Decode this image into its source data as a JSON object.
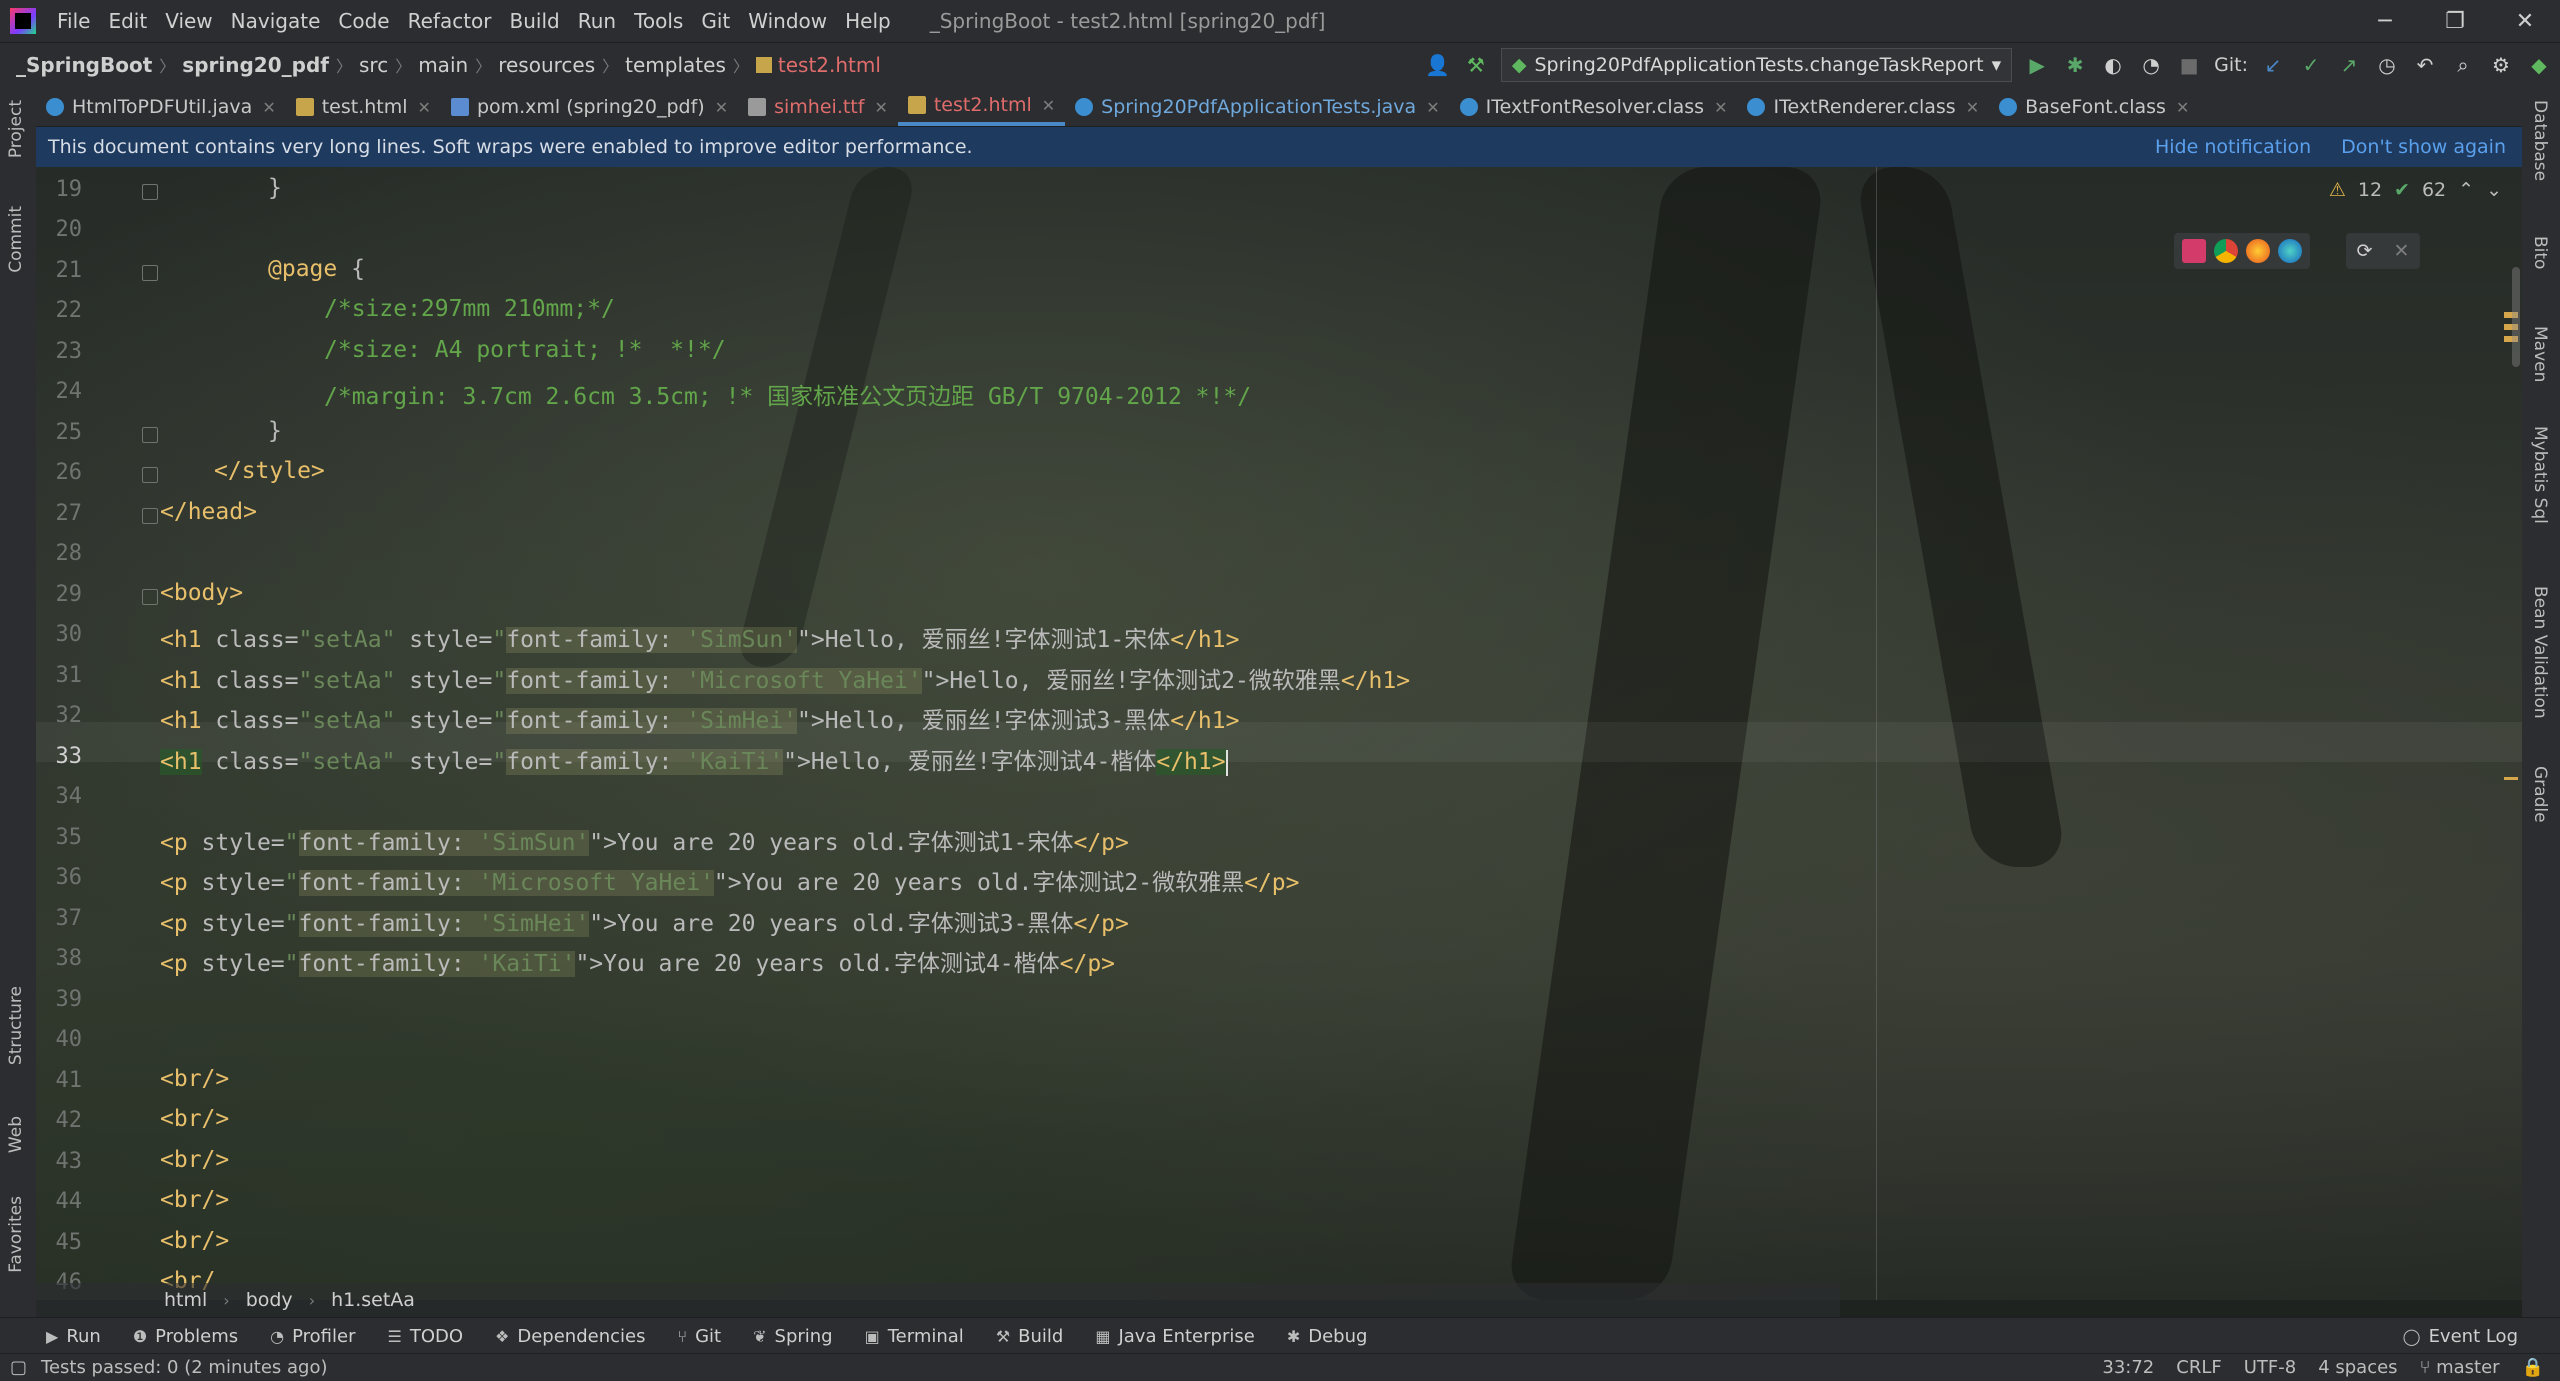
{
  "menu": [
    "File",
    "Edit",
    "View",
    "Navigate",
    "Code",
    "Refactor",
    "Build",
    "Run",
    "Tools",
    "Git",
    "Window",
    "Help"
  ],
  "window_title": "_SpringBoot - test2.html [spring20_pdf]",
  "breadcrumb_nav": [
    "_SpringBoot",
    "spring20_pdf",
    "src",
    "main",
    "resources",
    "templates",
    "test2.html"
  ],
  "run_config": "Spring20PdfApplicationTests.changeTaskReport",
  "git_label": "Git:",
  "tabs": [
    {
      "label": "HtmlToPDFUtil.java",
      "active": false,
      "color": "normal"
    },
    {
      "label": "test.html",
      "active": false,
      "color": "normal"
    },
    {
      "label": "pom.xml (spring20_pdf)",
      "active": false,
      "color": "normal"
    },
    {
      "label": "simhei.ttf",
      "active": false,
      "color": "red"
    },
    {
      "label": "test2.html",
      "active": true,
      "color": "red"
    },
    {
      "label": "Spring20PdfApplicationTests.java",
      "active": false,
      "color": "blue"
    },
    {
      "label": "ITextFontResolver.class",
      "active": false,
      "color": "normal"
    },
    {
      "label": "ITextRenderer.class",
      "active": false,
      "color": "normal"
    },
    {
      "label": "BaseFont.class",
      "active": false,
      "color": "normal"
    }
  ],
  "notification": {
    "message": "This document contains very long lines. Soft wraps were enabled to improve editor performance.",
    "hide": "Hide notification",
    "dont_show": "Don't show again"
  },
  "inspection": {
    "warnings": "12",
    "ok": "62"
  },
  "line_numbers": [
    "19",
    "20",
    "21",
    "22",
    "23",
    "24",
    "25",
    "26",
    "27",
    "28",
    "29",
    "30",
    "31",
    "32",
    "33",
    "34",
    "35",
    "36",
    "37",
    "38",
    "39",
    "40",
    "41",
    "42",
    "43",
    "44",
    "45",
    "46"
  ],
  "current_line": "33",
  "code": {
    "l19": "}",
    "l21_at": "@page",
    "l21_br": " {",
    "l22": "/*size:297mm 210mm;*/",
    "l23": "/*size: A4 portrait; !*  *!*/",
    "l24": "/*margin: 3.7cm 2.6cm 3.5cm; !* 国家标准公文页边距 GB/T 9704-2012 *!*/",
    "l25": "}",
    "l26": "</style>",
    "l27": "</head>",
    "l29": "<body>",
    "h1_open": "<h1",
    "h1_class_attr": " class=",
    "h1_class_val": "\"setAa\"",
    "style_attr": " style=",
    "style_q": "\"",
    "ff": "font-family: ",
    "l30_font": "'SimSun'",
    "l30_text": "\">Hello, 爱丽丝!字体测试1-宋体",
    "l31_font": "'Microsoft YaHei'",
    "l31_text": "\">Hello, 爱丽丝!字体测试2-微软雅黑",
    "l32_font": "'SimHei'",
    "l32_text": "\">Hello, 爱丽丝!字体测试3-黑体",
    "l33_font": "'KaiTi'",
    "l33_text": "\">Hello, 爱丽丝!字体测试4-楷体",
    "h1_close": "</h1>",
    "h1_close_open": "</h1",
    "h1_close_gt": ">",
    "p_open": "<p",
    "l35_font": "'SimSun'",
    "l35_text": "\">You are 20 years old.字体测试1-宋体",
    "l36_font": "'Microsoft YaHei'",
    "l36_text": "\">You are 20 years old.字体测试2-微软雅黑",
    "l37_font": "'SimHei'",
    "l37_text": "\">You are 20 years old.字体测试3-黑体",
    "l38_font": "'KaiTi'",
    "l38_text": "\">You are 20 years old.字体测试4-楷体",
    "p_close": "</p>",
    "br": "<br/>",
    "l46_partial": "<br/"
  },
  "breadcrumbs": [
    "html",
    "body",
    "h1.setAa"
  ],
  "tool_windows": [
    "Run",
    "Problems",
    "Profiler",
    "TODO",
    "Dependencies",
    "Git",
    "Spring",
    "Terminal",
    "Build",
    "Java Enterprise",
    "Debug"
  ],
  "event_log": "Event Log",
  "status": {
    "message": "Tests passed: 0 (2 minutes ago)",
    "position": "33:72",
    "line_sep": "CRLF",
    "encoding": "UTF-8",
    "indent": "4 spaces",
    "branch": "master"
  },
  "side_left": [
    "Project",
    "Commit",
    "Structure",
    "Web",
    "Favorites"
  ],
  "side_right": [
    "Database",
    "Bito",
    "Maven",
    "Mybatis Sql",
    "Bean Validation",
    "Gradle"
  ]
}
